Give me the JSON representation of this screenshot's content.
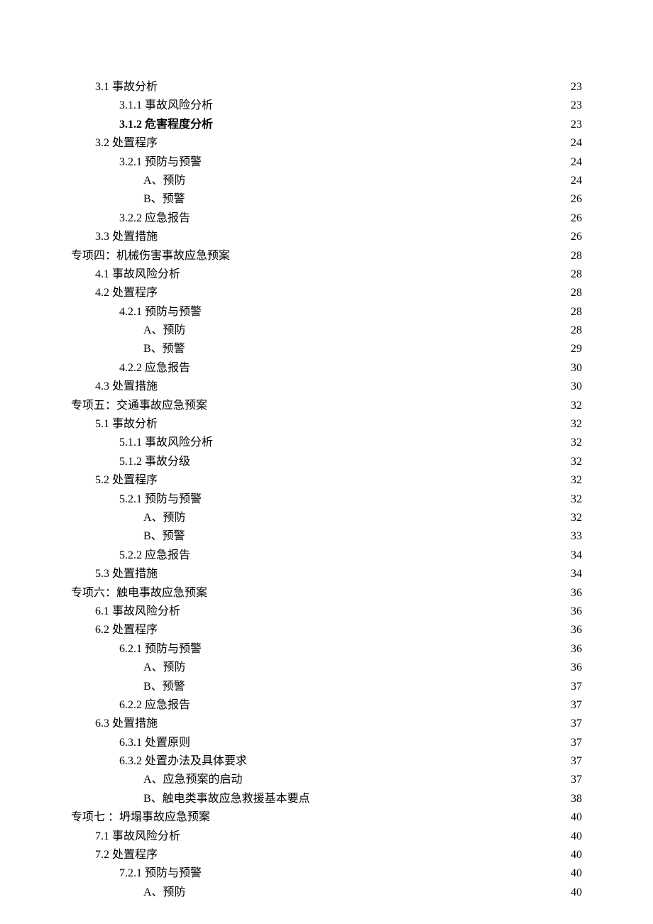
{
  "toc": [
    {
      "label": "3.1  事故分析",
      "page": "23",
      "indent": 1,
      "bold": false
    },
    {
      "label": "3.1.1 事故风险分析",
      "page": "23",
      "indent": 2,
      "bold": false
    },
    {
      "label": "3.1.2 危害程度分析",
      "page": "23",
      "indent": 2,
      "bold": true
    },
    {
      "label": "3.2 处置程序",
      "page": "24",
      "indent": 1,
      "bold": false
    },
    {
      "label": "3.2.1 预防与预警",
      "page": "24",
      "indent": 2,
      "bold": false
    },
    {
      "label": "A、预防",
      "page": "24",
      "indent": 3,
      "bold": false
    },
    {
      "label": "B、预警",
      "page": "26",
      "indent": 3,
      "bold": false
    },
    {
      "label": "3.2.2 应急报告",
      "page": "26",
      "indent": 2,
      "bold": false
    },
    {
      "label": "3.3 处置措施",
      "page": "26",
      "indent": 1,
      "bold": false
    },
    {
      "label": "专项四：机械伤害事故应急预案",
      "page": "28",
      "indent": 0,
      "bold": false
    },
    {
      "label": "4.1  事故风险分析",
      "page": "28",
      "indent": 1,
      "bold": false
    },
    {
      "label": "4.2 处置程序",
      "page": "28",
      "indent": 1,
      "bold": false
    },
    {
      "label": "4.2.1 预防与预警",
      "page": "28",
      "indent": 2,
      "bold": false
    },
    {
      "label": "A、预防",
      "page": "28",
      "indent": 3,
      "bold": false
    },
    {
      "label": "B、预警",
      "page": "29",
      "indent": 3,
      "bold": false
    },
    {
      "label": "4.2.2 应急报告",
      "page": "30",
      "indent": 2,
      "bold": false
    },
    {
      "label": "4.3 处置措施",
      "page": "30",
      "indent": 1,
      "bold": false
    },
    {
      "label": "专项五：交通事故应急预案",
      "page": "32",
      "indent": 0,
      "bold": false
    },
    {
      "label": "5.1  事故分析",
      "page": "32",
      "indent": 1,
      "bold": false
    },
    {
      "label": "5.1.1 事故风险分析",
      "page": "32",
      "indent": 2,
      "bold": false
    },
    {
      "label": "5.1.2 事故分级",
      "page": "32",
      "indent": 2,
      "bold": false
    },
    {
      "label": "5.2 处置程序",
      "page": "32",
      "indent": 1,
      "bold": false
    },
    {
      "label": "5.2.1 预防与预警",
      "page": "32",
      "indent": 2,
      "bold": false
    },
    {
      "label": "A、预防",
      "page": "32",
      "indent": 3,
      "bold": false
    },
    {
      "label": "B、预警",
      "page": "33",
      "indent": 3,
      "bold": false
    },
    {
      "label": "5.2.2 应急报告",
      "page": "34",
      "indent": 2,
      "bold": false
    },
    {
      "label": "5.3 处置措施",
      "page": "34",
      "indent": 1,
      "bold": false
    },
    {
      "label": "专项六：触电事故应急预案",
      "page": "36",
      "indent": 0,
      "bold": false
    },
    {
      "label": "6.1  事故风险分析",
      "page": "36",
      "indent": 1,
      "bold": false
    },
    {
      "label": "6.2 处置程序",
      "page": "36",
      "indent": 1,
      "bold": false
    },
    {
      "label": "6.2.1 预防与预警",
      "page": "36",
      "indent": 2,
      "bold": false
    },
    {
      "label": "A、预防",
      "page": "36",
      "indent": 3,
      "bold": false
    },
    {
      "label": "B、预警",
      "page": "37",
      "indent": 3,
      "bold": false
    },
    {
      "label": "6.2.2 应急报告",
      "page": "37",
      "indent": 2,
      "bold": false
    },
    {
      "label": "6.3 处置措施",
      "page": "37",
      "indent": 1,
      "bold": false
    },
    {
      "label": "6.3.1  处置原则",
      "page": "37",
      "indent": 2,
      "bold": false
    },
    {
      "label": "6.3.2 处置办法及具体要求",
      "page": "37",
      "indent": 2,
      "bold": false
    },
    {
      "label": "A、应急预案的启动",
      "page": "37",
      "indent": 3,
      "bold": false
    },
    {
      "label": "B、触电类事故应急救援基本要点",
      "page": "38",
      "indent": 3,
      "bold": false
    },
    {
      "label": "专项七 ：坍塌事故应急预案",
      "page": "40",
      "indent": 0,
      "bold": false
    },
    {
      "label": "7.1  事故风险分析",
      "page": "40",
      "indent": 1,
      "bold": false
    },
    {
      "label": "7.2 处置程序",
      "page": "40",
      "indent": 1,
      "bold": false
    },
    {
      "label": "7.2.1 预防与预警",
      "page": "40",
      "indent": 2,
      "bold": false
    },
    {
      "label": "A、预防",
      "page": "40",
      "indent": 3,
      "bold": false
    }
  ]
}
